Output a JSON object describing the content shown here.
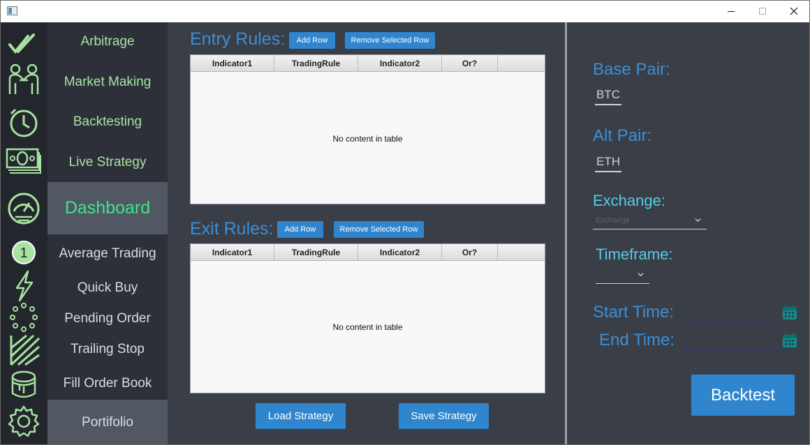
{
  "window": {
    "minimize_glyph": "—",
    "maximize_glyph": "□",
    "close_glyph": "✕"
  },
  "rail": {
    "icons": [
      "check-double-icon",
      "handshake-icon",
      "clock-icon",
      "money-icon",
      "gauge-icon",
      "number-one-icon",
      "lightning-icon",
      "loading-dots-icon",
      "chart-lines-icon",
      "paint-bucket-icon",
      "gear-icon"
    ],
    "accent": "#a6e3a1",
    "number_badge": "1"
  },
  "nav": {
    "items": [
      {
        "label": "Arbitrage"
      },
      {
        "label": "Market Making"
      },
      {
        "label": "Backtesting"
      },
      {
        "label": "Live Strategy"
      },
      {
        "label": "Dashboard"
      },
      {
        "label": "Average Trading"
      },
      {
        "label": "Quick Buy"
      },
      {
        "label": "Pending Order"
      },
      {
        "label": "Trailing Stop"
      },
      {
        "label": "Fill Order Book"
      },
      {
        "label": "Portifolio"
      }
    ]
  },
  "entry": {
    "title": "Entry Rules:",
    "add_row": "Add Row",
    "remove_row": "Remove Selected Row",
    "columns": [
      "Indicator1",
      "TradingRule",
      "Indicator2",
      "Or?"
    ],
    "empty": "No content in table"
  },
  "exit": {
    "title": "Exit Rules:",
    "add_row": "Add Row",
    "remove_row": "Remove Selected Row",
    "columns": [
      "Indicator1",
      "TradingRule",
      "Indicator2",
      "Or?"
    ],
    "empty": "No content in table"
  },
  "actions": {
    "load": "Load Strategy",
    "save": "Save Strategy"
  },
  "right": {
    "base_pair_label": "Base Pair:",
    "base_pair_value": "BTC",
    "alt_pair_label": "Alt Pair:",
    "alt_pair_value": "ETH",
    "exchange_label": "Exchange:",
    "exchange_placeholder": "Exchange",
    "timeframe_label": "Timeframe:",
    "start_label": "Start Time:",
    "end_label": "End Time:",
    "start_value": "",
    "end_value": "",
    "backtest": "Backtest"
  },
  "colors": {
    "accent_blue": "#2f86cf",
    "label_blue": "#3b8fd6",
    "nav_green": "#a6e3a1",
    "active_green": "#3fe38e",
    "background": "#3a3e47"
  }
}
